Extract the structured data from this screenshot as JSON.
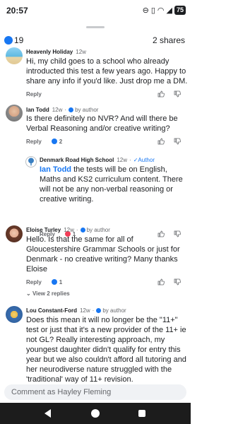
{
  "status": {
    "time": "20:57",
    "battery": "75"
  },
  "header": {
    "like_count": "19",
    "shares": "2 shares"
  },
  "comments": [
    {
      "name": "Heavenly Holiday",
      "time": "12w",
      "text": "Hi, my child goes to a school who already introducted this test a few years ago. Happy to share any info if you'd like. Just drop me a DM.",
      "reply": "Reply"
    },
    {
      "name": "Ian Todd",
      "time": "12w",
      "author_tag": "by author",
      "text": "Is there definitely no NVR? And will there be Verbal Reasoning and/or creative writing?",
      "reply": "Reply",
      "reaction_count": "2"
    },
    {
      "name": "Denmark Road High School",
      "time": "12w",
      "author_tag": "Author",
      "mention": "Ian Todd",
      "text": " the tests will be on English, Maths and KS2 curriculum content. There will not be any non-verbal reasoning or creative writing.",
      "reply": "Reply",
      "reaction_count": "1"
    },
    {
      "name": "Eloise Turley",
      "time": "12w",
      "author_tag": "by author",
      "text": "Hello. Is that the same for all of Gloucestershire Grammar Schools or just for Denmark - no creative writing? Many thanks Eloise",
      "reply": "Reply",
      "reaction_count": "1",
      "view_replies": "View 2 replies"
    },
    {
      "name": "Lou Constant-Ford",
      "time": "12w",
      "author_tag": "by author",
      "text": "Does this mean it will no longer be the \"11+\" test or just that it's a new provider of the 11+ ie not GL? Really interesting approach, my youngest daughter didn't qualify for entry this year but we also couldn't afford all tutoring and her neurodiverse nature struggled with the 'traditional' way of 11+ revision."
    }
  ],
  "compose": {
    "placeholder": "Comment as Hayley Fleming"
  }
}
